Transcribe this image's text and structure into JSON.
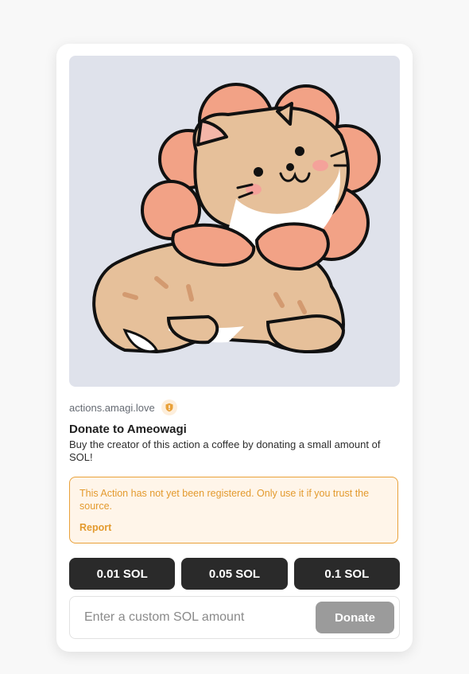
{
  "action": {
    "image_alt": "cat-in-flower-mane-illustration",
    "domain": "actions.amagi.love",
    "title": "Donate to Ameowagi",
    "description": "Buy the creator of this action a coffee by donating a small amount of SOL!"
  },
  "warning": {
    "text": "This Action has not yet been registered. Only use it if you trust the source.",
    "report_label": "Report"
  },
  "amounts": [
    {
      "label": "0.01 SOL"
    },
    {
      "label": "0.05 SOL"
    },
    {
      "label": "0.1 SOL"
    }
  ],
  "custom": {
    "placeholder": "Enter a custom SOL amount",
    "donate_label": "Donate"
  },
  "icons": {
    "domain_badge": "shield-icon"
  },
  "colors": {
    "warning": "#e39a2e",
    "button_dark": "#2a2a2a",
    "button_disabled": "#9b9b9b"
  }
}
